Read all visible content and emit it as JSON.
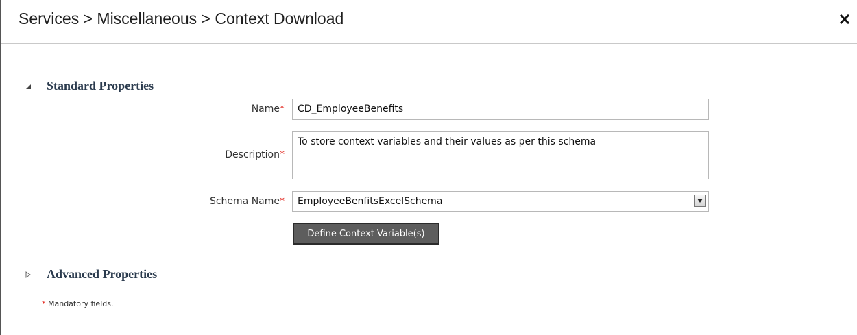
{
  "header": {
    "breadcrumb": "Services > Miscellaneous > Context Download",
    "close_icon": "close-icon"
  },
  "sections": {
    "standard": {
      "title": "Standard Properties",
      "expanded": true
    },
    "advanced": {
      "title": "Advanced Properties",
      "expanded": false
    }
  },
  "form": {
    "name": {
      "label": "Name",
      "value": "CD_EmployeeBenefits"
    },
    "description": {
      "label": "Description",
      "value": "To store context variables and their values as per this schema"
    },
    "schema": {
      "label": "Schema Name",
      "value": "EmployeeBenfitsExcelSchema"
    },
    "required_marker": "*",
    "define_button": "Define Context Variable(s)"
  },
  "footer": {
    "marker": "*",
    "mandatory_note": "Mandatory fields."
  },
  "colors": {
    "required": "#e2231a",
    "button_bg": "#5d5d5d",
    "section_title": "#2b3b4e"
  }
}
